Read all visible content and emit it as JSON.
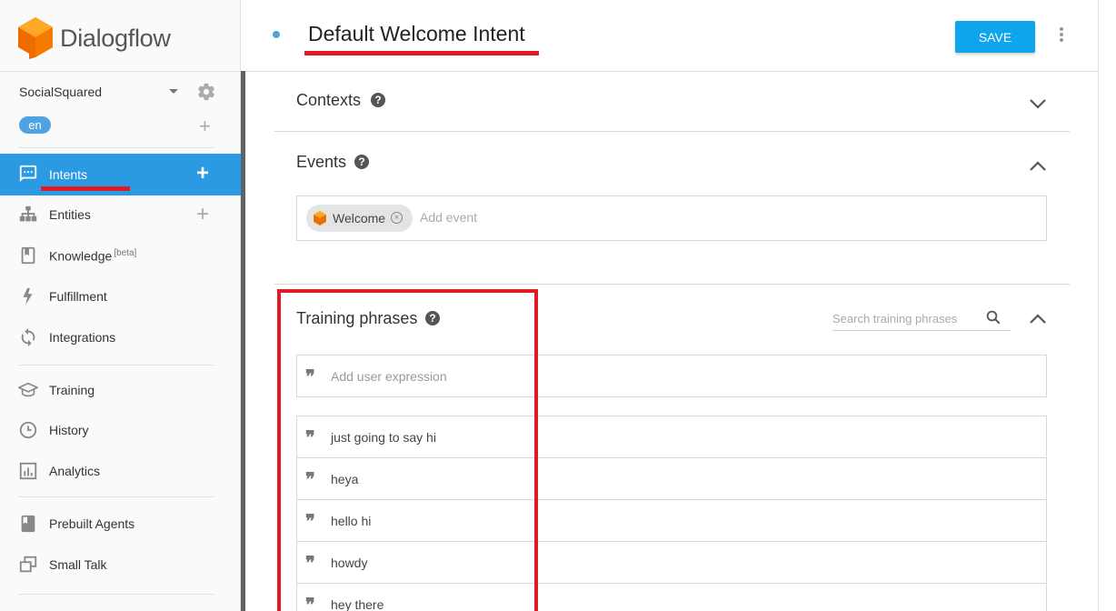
{
  "app": {
    "name": "Dialogflow"
  },
  "sidebar": {
    "agent_name": "SocialSquared",
    "language": "en",
    "nav": [
      {
        "label": "Intents",
        "icon": "chat-bubble-icon",
        "active": true,
        "has_add": true
      },
      {
        "label": "Entities",
        "icon": "hierarchy-icon",
        "active": false,
        "has_add": true
      },
      {
        "label": "Knowledge",
        "badge": "[beta]",
        "icon": "book-icon",
        "active": false,
        "has_add": false
      },
      {
        "label": "Fulfillment",
        "icon": "bolt-icon",
        "active": false,
        "has_add": false
      },
      {
        "label": "Integrations",
        "icon": "sync-icon",
        "active": false,
        "has_add": false
      },
      {
        "label": "Training",
        "icon": "graduation-cap-icon",
        "active": false,
        "has_add": false
      },
      {
        "label": "History",
        "icon": "clock-icon",
        "active": false,
        "has_add": false
      },
      {
        "label": "Analytics",
        "icon": "bar-chart-icon",
        "active": false,
        "has_add": false
      },
      {
        "label": "Prebuilt Agents",
        "icon": "bookmark-book-icon",
        "active": false,
        "has_add": false
      },
      {
        "label": "Small Talk",
        "icon": "chat-windows-icon",
        "active": false,
        "has_add": false
      }
    ]
  },
  "header": {
    "intent_title": "Default Welcome Intent",
    "save_label": "SAVE"
  },
  "contexts": {
    "title": "Contexts"
  },
  "events": {
    "title": "Events",
    "chips": [
      {
        "label": "Welcome"
      }
    ],
    "add_placeholder": "Add event"
  },
  "training": {
    "title": "Training phrases",
    "search_placeholder": "Search training phrases",
    "add_placeholder": "Add user expression",
    "phrases": [
      "just going to say hi",
      "heya",
      "hello hi",
      "howdy",
      "hey there"
    ]
  },
  "colors": {
    "accent": "#2b9ae3",
    "save": "#0ea5ec",
    "highlight": "#e01b24",
    "logo": "#ff9800"
  }
}
